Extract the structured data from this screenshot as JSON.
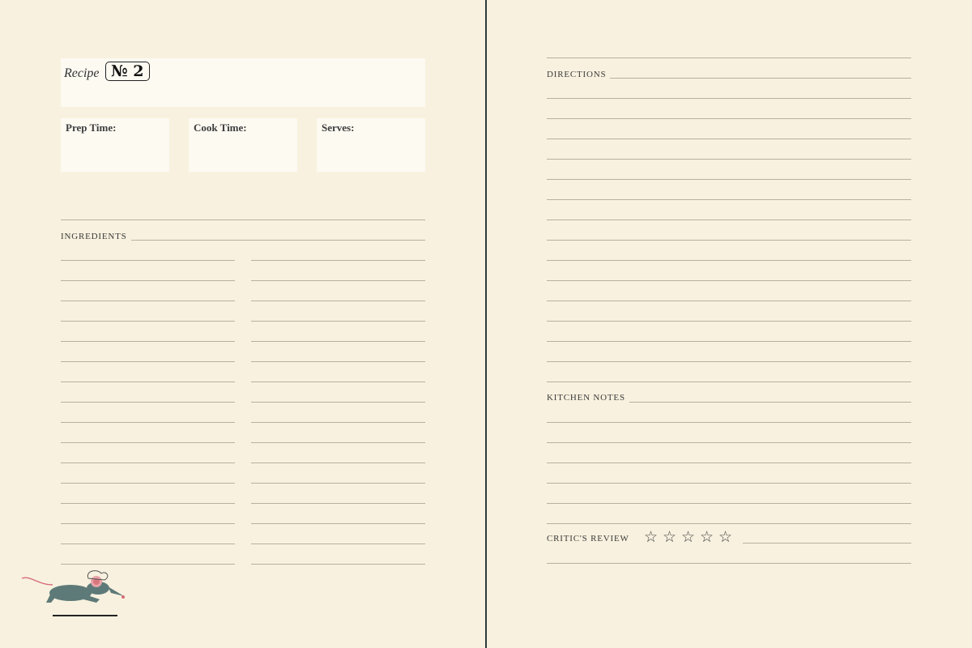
{
  "recipe": {
    "word": "Recipe",
    "number": "№ 2"
  },
  "fields": {
    "prep": "Prep Time:",
    "cook": "Cook Time:",
    "serves": "Serves:"
  },
  "sections": {
    "ingredients": "INGREDIENTS",
    "directions": "DIRECTIONS",
    "kitchen_notes": "KITCHEN NOTES",
    "critics_review": "CRITIC'S REVIEW"
  },
  "rating": {
    "stars_total": 5,
    "stars_filled": 0,
    "star_glyph": "☆"
  },
  "colors": {
    "paper": "#f8f1df",
    "box": "#fdfaf2",
    "rule": "#b9b0a0",
    "spine": "#2f3a3a"
  },
  "illustration": "running-mouse-chef"
}
